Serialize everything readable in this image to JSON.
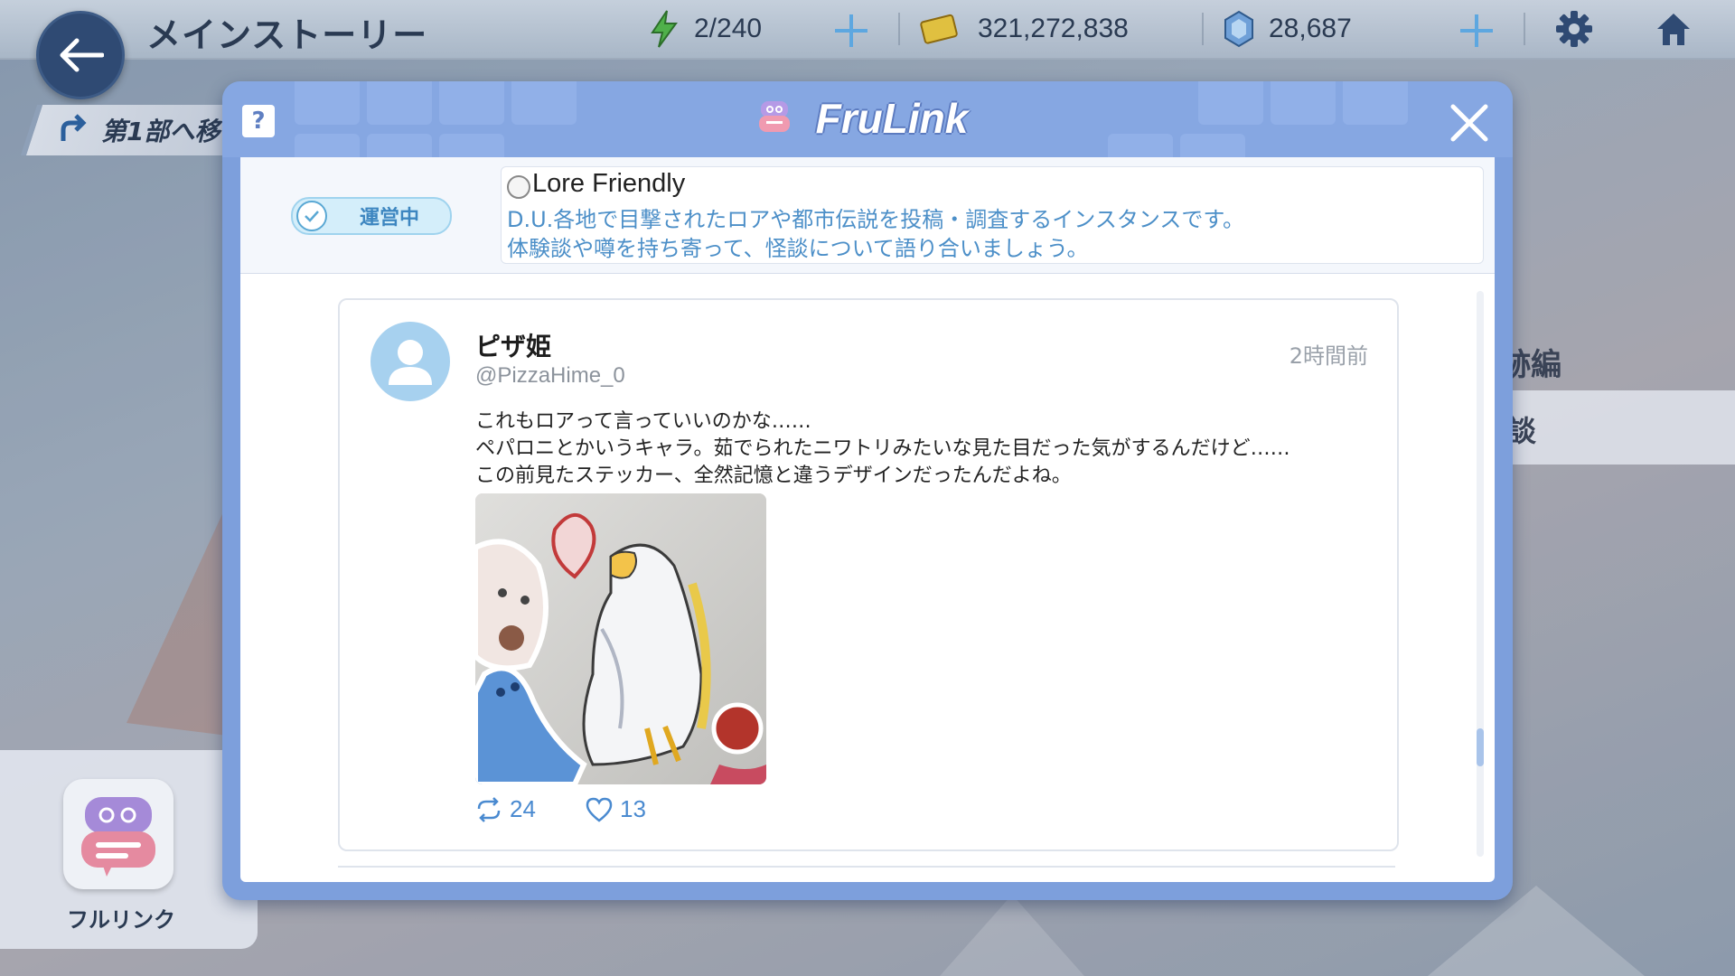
{
  "header": {
    "screen_title": "メインストーリー",
    "stamina": "2/240",
    "credits": "321,272,838",
    "pyroxene": "28,687"
  },
  "left": {
    "part_button_label": "第1部へ移",
    "frulink_label": "フルリンク"
  },
  "right": {
    "label1": "跡編",
    "label2": "談"
  },
  "modal": {
    "title": "FruLink",
    "help": "?",
    "status": "運営中",
    "instance_name": "Lore Friendly",
    "description": [
      "D.U.各地で目撃されたロアや都市伝説を投稿・調査するインスタンスです。",
      "体験談や噂を持ち寄って、怪談について語り合いましょう。"
    ]
  },
  "post": {
    "author": "ピザ姫",
    "handle": "@PizzaHime_0",
    "time": "2時間前",
    "lines": [
      "これもロアって言っていいのかな……",
      "ペパロニとかいうキャラ。茹でられたニワトリみたいな見た目だった気がするんだけど……",
      "この前見たステッカー、全然記憶と違うデザインだったんだよね。"
    ],
    "reposts": "24",
    "likes": "13"
  },
  "colors": {
    "accent": "#7d9fdc",
    "status_text": "#3d86c0",
    "description_text": "#4c8fc8",
    "stat_text": "#4a8ad0"
  }
}
